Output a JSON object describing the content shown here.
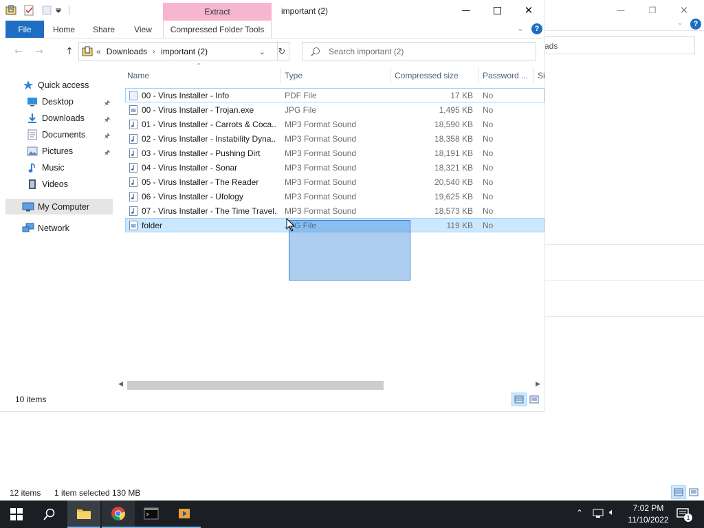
{
  "window": {
    "title": "important (2)",
    "context_tab": "Extract",
    "context_group": "Compressed Folder Tools"
  },
  "ribbon": {
    "tabs": [
      "File",
      "Home",
      "Share",
      "View"
    ]
  },
  "address": {
    "breadcrumb_sep": "«",
    "path": [
      "Downloads",
      "important (2)"
    ],
    "search_placeholder": "Search important (2)"
  },
  "nav": {
    "quick_access": "Quick access",
    "items": [
      {
        "label": "Desktop",
        "icon": "desktop-icon",
        "pinned": true
      },
      {
        "label": "Downloads",
        "icon": "downloads-icon",
        "pinned": true
      },
      {
        "label": "Documents",
        "icon": "documents-icon",
        "pinned": true
      },
      {
        "label": "Pictures",
        "icon": "pictures-icon",
        "pinned": true
      },
      {
        "label": "Music",
        "icon": "music-icon",
        "pinned": false
      },
      {
        "label": "Videos",
        "icon": "videos-icon",
        "pinned": false
      }
    ],
    "my_computer": "My Computer",
    "network": "Network"
  },
  "columns": {
    "name": "Name",
    "type": "Type",
    "compressed_size": "Compressed size",
    "password": "Password ...",
    "size": "Si"
  },
  "files": [
    {
      "name": "00 - Virus Installer - Info",
      "type": "PDF File",
      "size": "17 KB",
      "password": "No",
      "icon": "pdf-file-icon"
    },
    {
      "name": "00 - Virus Installer - Trojan.exe",
      "type": "JPG File",
      "size": "1,495 KB",
      "password": "No",
      "icon": "jpg-file-icon"
    },
    {
      "name": "01 - Virus Installer - Carrots & Coca...",
      "type": "MP3 Format Sound",
      "size": "18,590 KB",
      "password": "No",
      "icon": "audio-file-icon"
    },
    {
      "name": "02 - Virus Installer - Instability Dyna...",
      "type": "MP3 Format Sound",
      "size": "18,358 KB",
      "password": "No",
      "icon": "audio-file-icon"
    },
    {
      "name": "03 - Virus Installer - Pushing Dirt",
      "type": "MP3 Format Sound",
      "size": "18,191 KB",
      "password": "No",
      "icon": "audio-file-icon"
    },
    {
      "name": "04 - Virus Installer - Sonar",
      "type": "MP3 Format Sound",
      "size": "18,321 KB",
      "password": "No",
      "icon": "audio-file-icon"
    },
    {
      "name": "05 - Virus Installer - The Reader",
      "type": "MP3 Format Sound",
      "size": "20,540 KB",
      "password": "No",
      "icon": "audio-file-icon"
    },
    {
      "name": "06 - Virus Installer - Ufology",
      "type": "MP3 Format Sound",
      "size": "19,625 KB",
      "password": "No",
      "icon": "audio-file-icon"
    },
    {
      "name": "07 - Virus Installer - The Time Travel...",
      "type": "MP3 Format Sound",
      "size": "18,573 KB",
      "password": "No",
      "icon": "audio-file-icon"
    },
    {
      "name": "folder",
      "type": "JPG File",
      "size": "119 KB",
      "password": "No",
      "icon": "jpg-file-icon",
      "selected": true
    }
  ],
  "status": {
    "front_count": "10 items",
    "back_count": "12 items",
    "back_selected": "1 item selected",
    "back_size": "130 MB"
  },
  "background_window": {
    "search_fragment": "ads"
  },
  "taskbar": {
    "time": "7:02 PM",
    "date": "11/10/2022",
    "notification_count": "1"
  },
  "colors": {
    "file_tab": "#1e6fc1",
    "context_tab": "#f7b6d0",
    "selection": "#cce8ff",
    "marquee": "#3a7fd5",
    "taskbar": "#1b1f24"
  }
}
